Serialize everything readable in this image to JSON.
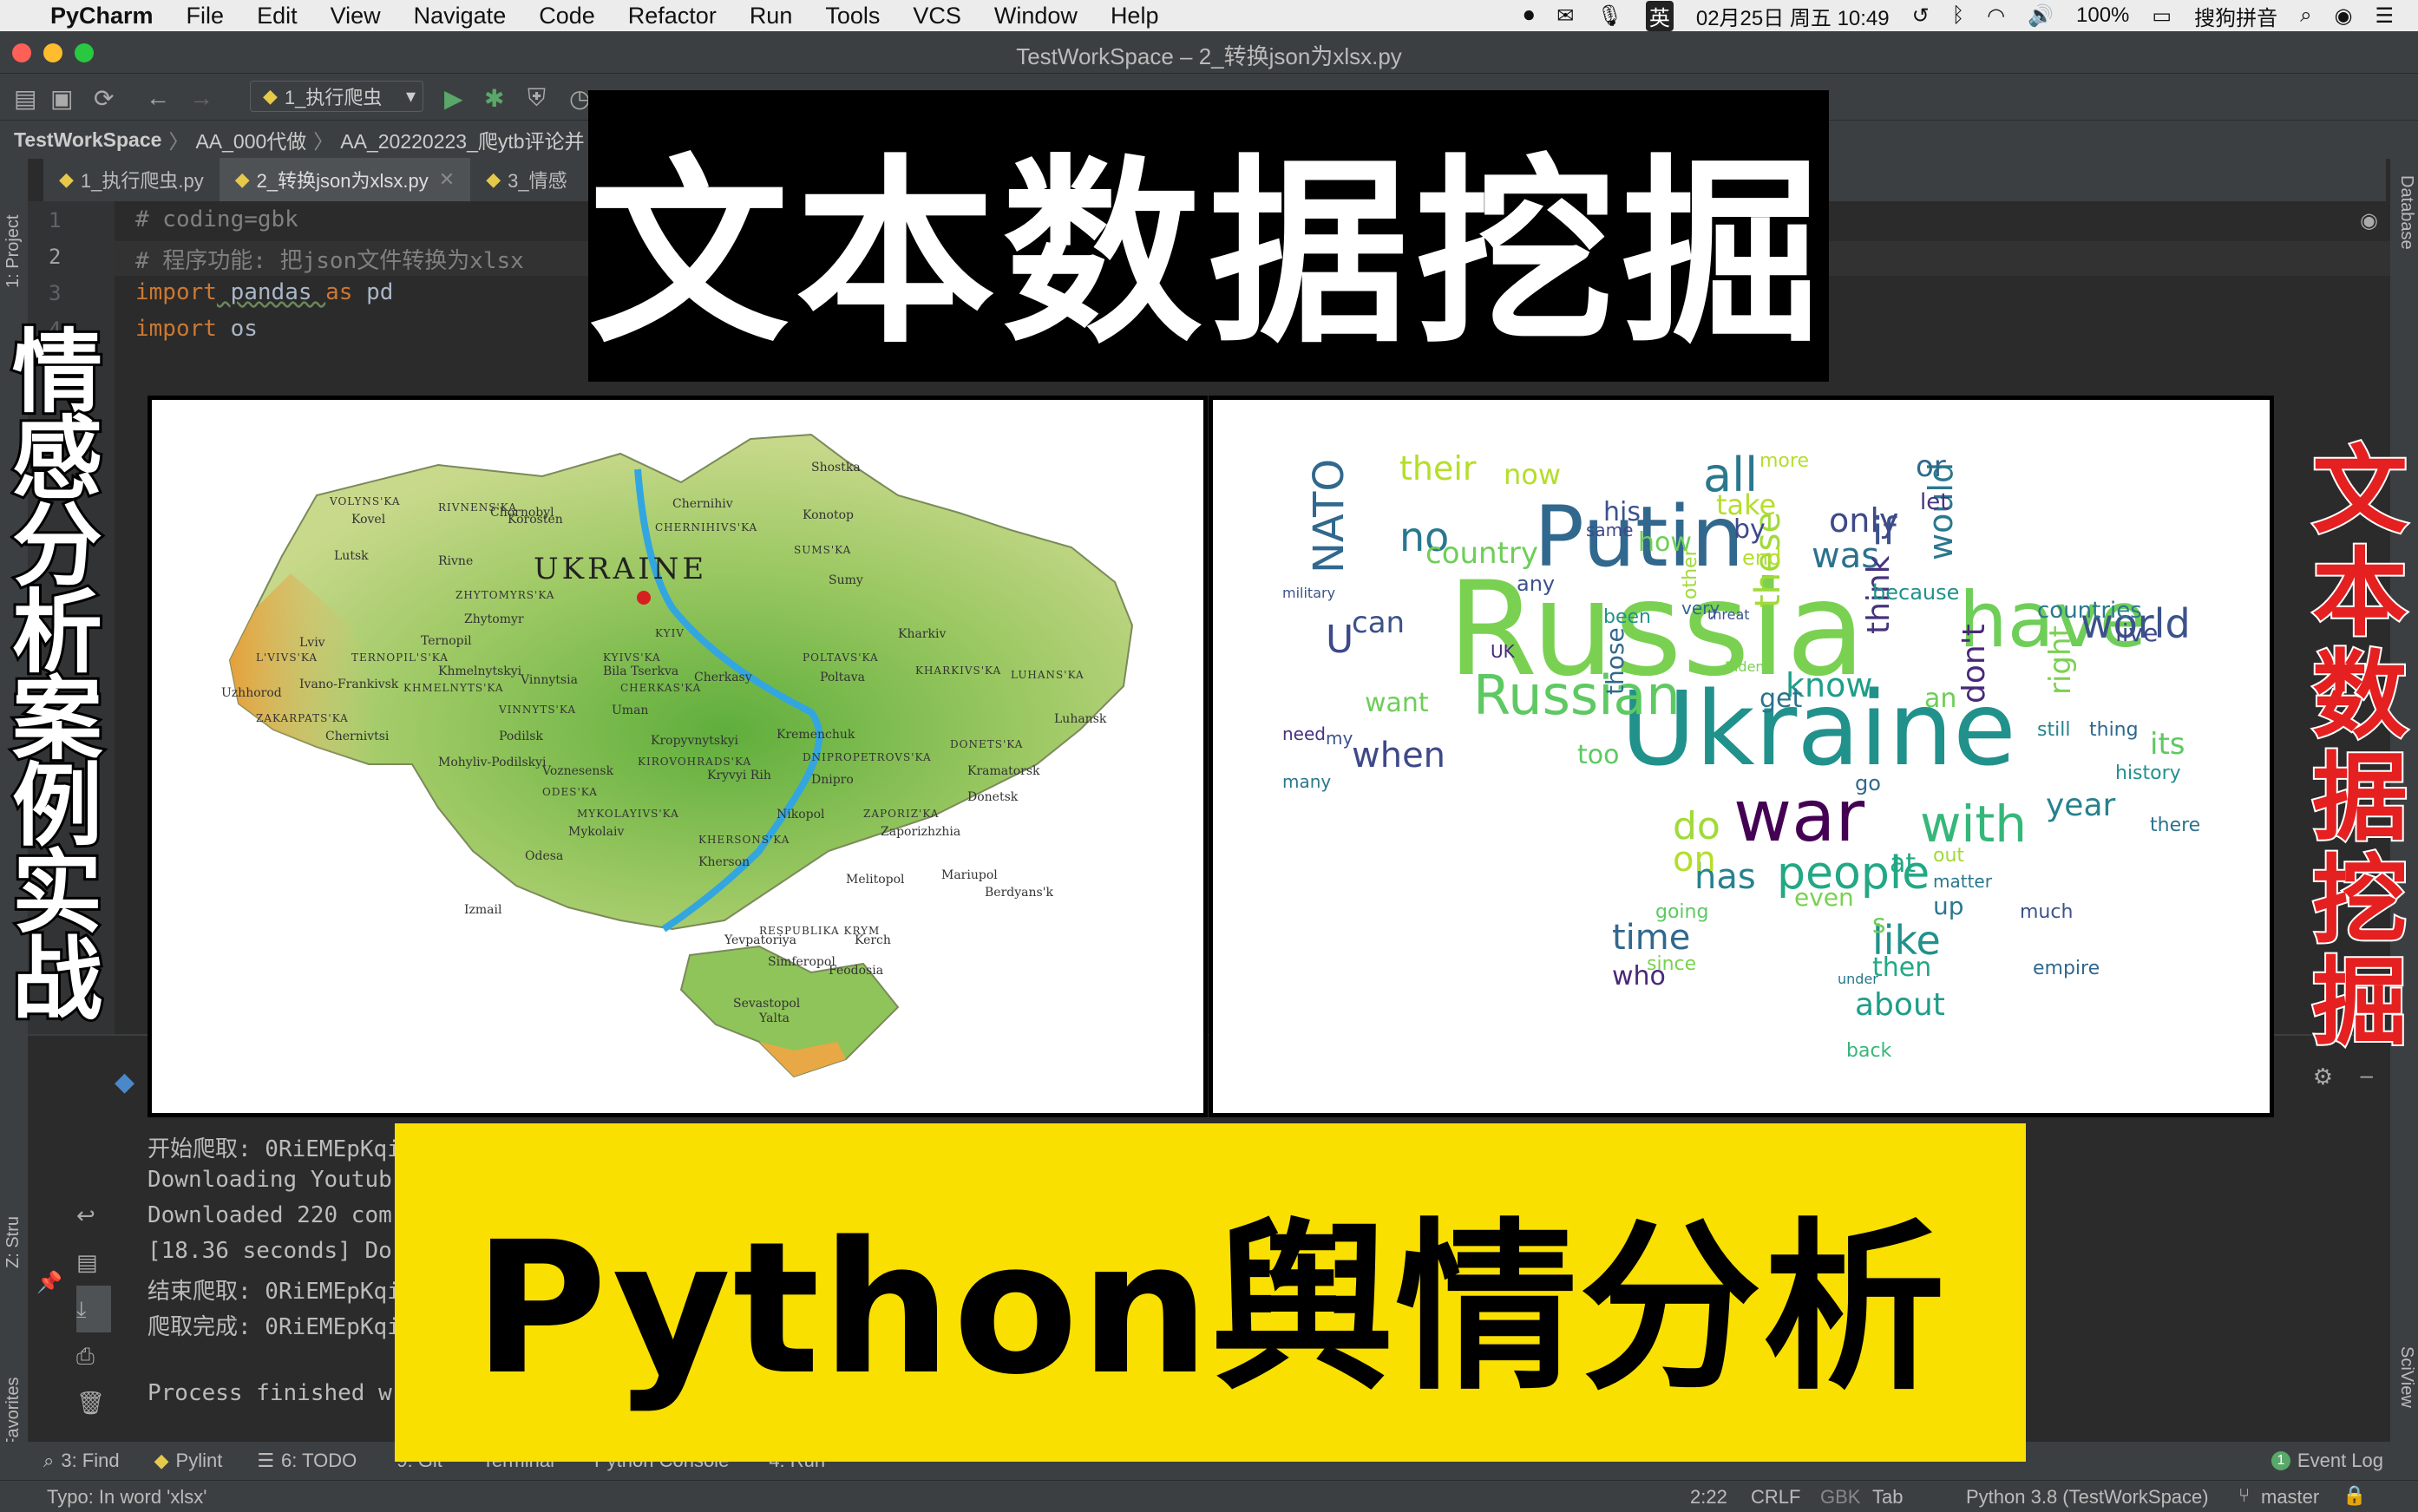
{
  "menubar": {
    "app": "PyCharm",
    "items": [
      "File",
      "Edit",
      "View",
      "Navigate",
      "Code",
      "Refactor",
      "Run",
      "Tools",
      "VCS",
      "Window",
      "Help"
    ],
    "status": {
      "input_method": "英",
      "datetime": "02月25日 周五 10:49",
      "battery": "100%",
      "ime_name": "搜狗拼音"
    }
  },
  "window": {
    "title": "TestWorkSpace – 2_转换json为xlsx.py"
  },
  "toolbar": {
    "run_config": "1_执行爬虫"
  },
  "breadcrumb": [
    "TestWorkSpace",
    "AA_000代做",
    "AA_20220223_爬ytb评论并"
  ],
  "tabs": [
    {
      "label": "1_执行爬虫.py"
    },
    {
      "label": "2_转换json为xlsx.py"
    },
    {
      "label": "3_情感"
    }
  ],
  "side_tabs": {
    "project": "1: Project",
    "structure": "Z: Stru",
    "favorites": "2: Favorites",
    "database": "Database",
    "sciview": "SciView"
  },
  "editor": {
    "lines": [
      {
        "num": "1",
        "text": "# coding=gbk",
        "kind": "comment"
      },
      {
        "num": "2",
        "text": "# 程序功能: 把json文件转换为xlsx",
        "kind": "comment"
      },
      {
        "num": "3",
        "kw1": "import",
        "mid": " pandas ",
        "kw2": "as",
        "tail": " pd",
        "kind": "import_as"
      },
      {
        "num": "4",
        "kw1": "import",
        "tail": " os",
        "kind": "import"
      }
    ]
  },
  "run_output": [
    "开始爬取: 0RiEMEpKqi",
    "Downloading Youtub",
    "Downloaded 220 com",
    "[18.36 seconds] Do",
    "结束爬取: 0RiEMEpKqi",
    "爬取完成: 0RiEMEpKqi",
    "",
    "Process finished w"
  ],
  "bottom_tools": [
    "3: Find",
    "Pylint",
    "6: TODO",
    "9: Git",
    "Terminal",
    "Python Console",
    "4: Run"
  ],
  "event_log": "Event Log",
  "status_bar": {
    "message": "Typo: In word 'xlsx'",
    "position": "2:22",
    "line_sep": "CRLF",
    "encoding": "GBK",
    "indent": "Tab",
    "interpreter": "Python 3.8 (TestWorkSpace)",
    "branch": "master"
  },
  "overlay": {
    "top_banner": "文本数据挖掘",
    "bottom_banner": "Python舆情分析",
    "left_vertical": [
      "情",
      "感",
      "分",
      "析",
      "案",
      "例",
      "实",
      "战"
    ],
    "right_vertical": [
      "文",
      "本",
      "数",
      "据",
      "挖",
      "掘"
    ],
    "map_title": "UKRAINE",
    "map_labels": [
      "VOLYNS'KA",
      "RIVNENS'KA",
      "Chernihiv",
      "KYIV",
      "SUMS'KA",
      "ZHYTOMYRS'KA",
      "Lutsk",
      "Rivne",
      "Lviv",
      "L'VIVS'KA",
      "TERNOPIL'S'KA",
      "Khmelnytskyi",
      "KHMELNYTS'KA",
      "Vinnytsia",
      "KYIVS'KA",
      "CHERKAS'KA",
      "POLTAVS'KA",
      "Poltava",
      "KHARKIVS'KA",
      "Kharkiv",
      "LUHANS'KA",
      "Luhansk",
      "DONETS'KA",
      "Donetsk",
      "DNIPROPETROVS'KA",
      "Dnipro",
      "KIROVOHRADS'KA",
      "Kropyvnytskyi",
      "Ivano-Frankivsk",
      "Uzhhorod",
      "ZAKARPATS'KA",
      "Chernivtsi",
      "VINNYTS'KA",
      "ODES'KA",
      "Odesa",
      "MYKOLAYIVS'KA",
      "Mykolaiv",
      "KHERSONS'KA",
      "Kherson",
      "ZAPORIZ'KA",
      "Zaporizhzhia",
      "RESPUBLIKA KRYM",
      "Simferopol",
      "Sevastopol",
      "Yalta",
      "Kerch",
      "Feodosia",
      "Melitopol",
      "Mariupol",
      "Cherkasy",
      "Sumy",
      "Shostka",
      "Kovel",
      "Konotop",
      "CHERNIHIVS'KA",
      "Zhytomyr",
      "Uman",
      "Kremenchuk",
      "Kramatorsk",
      "Berdyans'k",
      "Ternopil",
      "Bila Tserkva",
      "Korosten",
      "Chornobyl",
      "Mohyliv-Podilskyi",
      "Izmail",
      "Yevpatoriya",
      "Nikopol",
      "Kryvyi Rih",
      "Voznesensk",
      "Podilsk"
    ],
    "wordcloud": [
      {
        "w": "Russia",
        "s": 150,
        "c": "#7ad151"
      },
      {
        "w": "Ukraine",
        "s": 118,
        "c": "#21918c"
      },
      {
        "w": "Putin",
        "s": 96,
        "c": "#31688e"
      },
      {
        "w": "have",
        "s": 88,
        "c": "#6ece58"
      },
      {
        "w": "war",
        "s": 82,
        "c": "#440154"
      },
      {
        "w": "Russian",
        "s": 62,
        "c": "#5ec962"
      },
      {
        "w": "world",
        "s": 46,
        "c": "#3b528b"
      },
      {
        "w": "with",
        "s": 58,
        "c": "#35b779"
      },
      {
        "w": "people",
        "s": 52,
        "c": "#22a884"
      },
      {
        "w": "all",
        "s": 54,
        "c": "#2a788e"
      },
      {
        "w": "NATO",
        "s": 48,
        "c": "#31688e"
      },
      {
        "w": "when",
        "s": 40,
        "c": "#3e4989"
      },
      {
        "w": "no",
        "s": 46,
        "c": "#2a788e"
      },
      {
        "w": "country",
        "s": 34,
        "c": "#6ece58"
      },
      {
        "w": "their",
        "s": 38,
        "c": "#b5de2b"
      },
      {
        "w": "now",
        "s": 32,
        "c": "#b5de2b"
      },
      {
        "w": "was",
        "s": 40,
        "c": "#2c728e"
      },
      {
        "w": "if",
        "s": 44,
        "c": "#3b528b"
      },
      {
        "w": "only",
        "s": 38,
        "c": "#3e4989"
      },
      {
        "w": "know",
        "s": 38,
        "c": "#1f9e89"
      },
      {
        "w": "year",
        "s": 36,
        "c": "#26828e"
      },
      {
        "w": "these",
        "s": 40,
        "c": "#a0da39"
      },
      {
        "w": "would",
        "s": 38,
        "c": "#2a788e"
      },
      {
        "w": "think",
        "s": 36,
        "c": "#46327e"
      },
      {
        "w": "don't",
        "s": 36,
        "c": "#482878"
      },
      {
        "w": "right",
        "s": 34,
        "c": "#7ad151"
      },
      {
        "w": "time",
        "s": 40,
        "c": "#31688e"
      },
      {
        "w": "like",
        "s": 46,
        "c": "#21918c"
      },
      {
        "w": "about",
        "s": 36,
        "c": "#1f9e89"
      },
      {
        "w": "has",
        "s": 40,
        "c": "#26828e"
      },
      {
        "w": "do",
        "s": 44,
        "c": "#a0da39"
      },
      {
        "w": "on",
        "s": 40,
        "c": "#b5de2b"
      },
      {
        "w": "can",
        "s": 34,
        "c": "#3b528b"
      },
      {
        "w": "want",
        "s": 30,
        "c": "#6ece58"
      },
      {
        "w": "too",
        "s": 30,
        "c": "#5ec962"
      },
      {
        "w": "who",
        "s": 30,
        "c": "#482878"
      },
      {
        "w": "then",
        "s": 30,
        "c": "#22a884"
      },
      {
        "w": "even",
        "s": 28,
        "c": "#7ad151"
      },
      {
        "w": "countries",
        "s": 26,
        "c": "#2a788e"
      },
      {
        "w": "live",
        "s": 28,
        "c": "#3e4989"
      },
      {
        "w": "its",
        "s": 34,
        "c": "#5ec962"
      },
      {
        "w": "history",
        "s": 22,
        "c": "#21918c"
      },
      {
        "w": "there",
        "s": 22,
        "c": "#2c728e"
      },
      {
        "w": "empire",
        "s": 22,
        "c": "#31688e"
      },
      {
        "w": "back",
        "s": 22,
        "c": "#35b779"
      },
      {
        "w": "take",
        "s": 32,
        "c": "#b5de2b"
      },
      {
        "w": "his",
        "s": 30,
        "c": "#3b528b"
      },
      {
        "w": "how",
        "s": 30,
        "c": "#6ece58"
      },
      {
        "w": "by",
        "s": 30,
        "c": "#3e4989"
      },
      {
        "w": "or",
        "s": 34,
        "c": "#31688e"
      },
      {
        "w": "let",
        "s": 26,
        "c": "#46327e"
      },
      {
        "w": "because",
        "s": 24,
        "c": "#21918c"
      },
      {
        "w": "get",
        "s": 30,
        "c": "#2c728e"
      },
      {
        "w": "those",
        "s": 28,
        "c": "#31688e"
      },
      {
        "w": "still",
        "s": 22,
        "c": "#26828e"
      },
      {
        "w": "thing",
        "s": 22,
        "c": "#31688e"
      },
      {
        "w": "at",
        "s": 30,
        "c": "#22a884"
      },
      {
        "w": "out",
        "s": 22,
        "c": "#a0da39"
      },
      {
        "w": "up",
        "s": 28,
        "c": "#2a788e"
      },
      {
        "w": "s",
        "s": 30,
        "c": "#6ece58"
      },
      {
        "w": "since",
        "s": 22,
        "c": "#7ad151"
      },
      {
        "w": "going",
        "s": 22,
        "c": "#5ec962"
      },
      {
        "w": "much",
        "s": 22,
        "c": "#3b528b"
      },
      {
        "w": "matter",
        "s": 20,
        "c": "#2a788e"
      },
      {
        "w": "other",
        "s": 22,
        "c": "#a0da39"
      },
      {
        "w": "U",
        "s": 44,
        "c": "#3e4989"
      },
      {
        "w": "UK",
        "s": 20,
        "c": "#482878"
      },
      {
        "w": "need",
        "s": 20,
        "c": "#46327e"
      },
      {
        "w": "my",
        "s": 20,
        "c": "#3b528b"
      },
      {
        "w": "many",
        "s": 20,
        "c": "#2a788e"
      },
      {
        "w": "any",
        "s": 24,
        "c": "#3b528b"
      },
      {
        "w": "end",
        "s": 24,
        "c": "#b5de2b"
      },
      {
        "w": "very",
        "s": 20,
        "c": "#31688e"
      },
      {
        "w": "an",
        "s": 30,
        "c": "#6ece58"
      },
      {
        "w": "go",
        "s": 24,
        "c": "#31688e"
      },
      {
        "w": "same",
        "s": 20,
        "c": "#3e4989"
      },
      {
        "w": "more",
        "s": 22,
        "c": "#b5de2b"
      },
      {
        "w": "under",
        "s": 16,
        "c": "#2a788e"
      },
      {
        "w": "military",
        "s": 16,
        "c": "#3b528b"
      },
      {
        "w": "been",
        "s": 22,
        "c": "#21918c"
      },
      {
        "w": "threat",
        "s": 16,
        "c": "#3b528b"
      },
      {
        "w": "Biden",
        "s": 16,
        "c": "#7ad151"
      }
    ]
  }
}
